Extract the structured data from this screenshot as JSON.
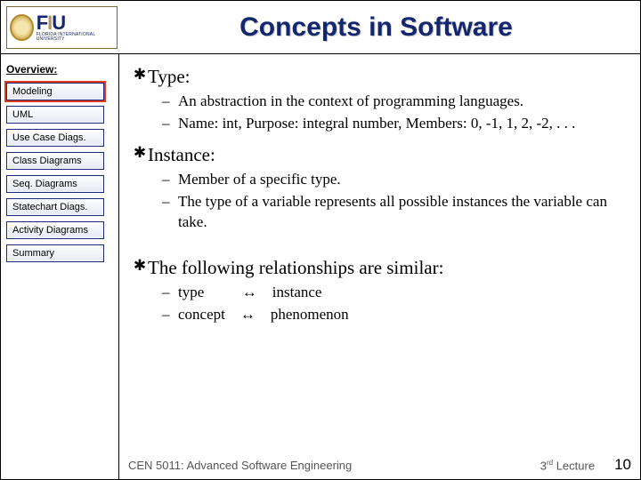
{
  "header": {
    "title": "Concepts in Software",
    "logo": {
      "initials_f": "F",
      "initials_i": "I",
      "initials_u": "U",
      "subtitle": "FLORIDA INTERNATIONAL UNIVERSITY"
    }
  },
  "sidebar": {
    "heading": "Overview:",
    "items": [
      {
        "label": "Modeling",
        "active": true
      },
      {
        "label": "UML",
        "active": false
      },
      {
        "label": "Use Case Diags.",
        "active": false
      },
      {
        "label": "Class Diagrams",
        "active": false
      },
      {
        "label": "Seq. Diagrams",
        "active": false
      },
      {
        "label": "Statechart Diags.",
        "active": false
      },
      {
        "label": "Activity Diagrams",
        "active": false
      },
      {
        "label": "Summary",
        "active": false
      }
    ]
  },
  "content": {
    "b1": {
      "heading": "Type:",
      "items": [
        " An abstraction in the context of programming languages.",
        "Name: int, Purpose: integral number, Members: 0, -1, 1, 2, -2, . . ."
      ]
    },
    "b2": {
      "heading": "Instance:",
      "items": [
        "Member of a specific type.",
        "The type of a variable represents all possible instances the variable can take."
      ]
    },
    "b3": {
      "heading": "The following relationships are similar:",
      "rel1_left": "type",
      "rel1_arrow": "↔",
      "rel1_right": "instance",
      "rel2_left": "concept",
      "rel2_arrow": "↔",
      "rel2_right": "phenomenon"
    }
  },
  "footer": {
    "course": "CEN 5011: Advanced Software Engineering",
    "lecture_pre": "3",
    "lecture_sup": "rd",
    "lecture_post": " Lecture",
    "page": "10"
  }
}
